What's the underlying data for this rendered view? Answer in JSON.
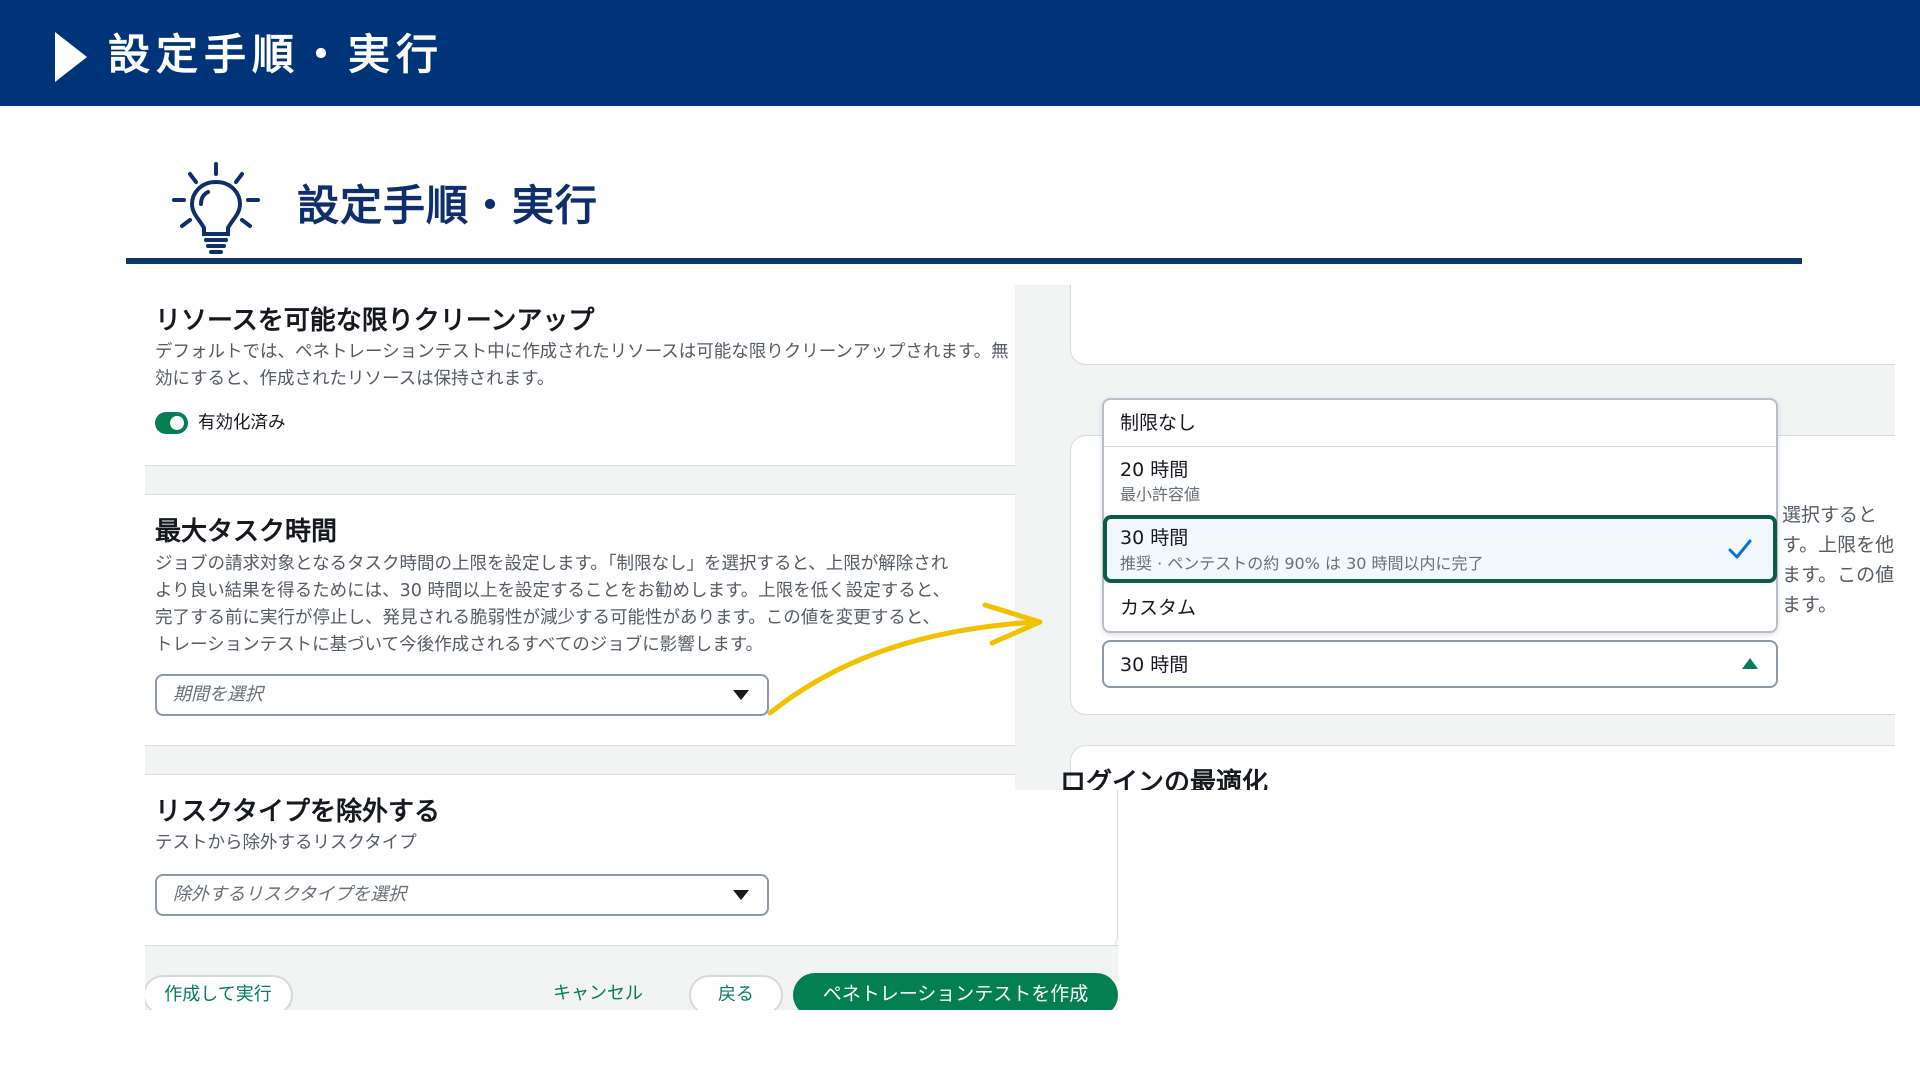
{
  "header": {
    "title": "設定手順・実行"
  },
  "section": {
    "title": "設定手順・実行"
  },
  "left": {
    "cleanup": {
      "title": "リソースを可能な限りクリーンアップ",
      "desc_line1": "デフォルトでは、ペネトレーションテスト中に作成されたリソースは可能な限りクリーンアップされます。無",
      "desc_line2": "効にすると、作成されたリソースは保持されます。",
      "toggle_label": "有効化済み",
      "toggle_state": "on"
    },
    "max_task": {
      "title": "最大タスク時間",
      "desc_line1": "ジョブの請求対象となるタスク時間の上限を設定します。「制限なし」を選択すると、上限が解除され",
      "desc_line2": "より良い結果を得るためには、30 時間以上を設定することをお勧めします。上限を低く設定すると、",
      "desc_line3": "完了する前に実行が停止し、発見される脆弱性が減少する可能性があります。この値を変更すると、",
      "desc_line4": "トレーションテストに基づいて今後作成されるすべてのジョブに影響します。",
      "placeholder": "期間を選択"
    },
    "exclude_risk": {
      "title": "リスクタイプを除外する",
      "desc": "テストから除外するリスクタイプ",
      "placeholder": "除外するリスクタイプを選択"
    },
    "buttons": {
      "create_and_run": "作成して実行",
      "cancel": "キャンセル",
      "back": "戻る",
      "create_pentest": "ペネトレーションテストを作成"
    }
  },
  "right": {
    "side_text": [
      "選択すると",
      "す。上限を他",
      "ます。この値",
      "ます。"
    ],
    "next_section_peek": "ログインの最適化",
    "dropdown": {
      "options": [
        {
          "label": "制限なし",
          "sub": ""
        },
        {
          "label": "20 時間",
          "sub": "最小許容値"
        },
        {
          "label": "30 時間",
          "sub": "推奨 · ペンテストの約 90% は 30 時間以内に完了",
          "selected": true
        },
        {
          "label": "カスタム",
          "sub": ""
        }
      ],
      "check_glyph": "✓"
    },
    "select_value": "30 時間"
  },
  "colors": {
    "header_bg": "#003478",
    "accent_green": "#037f51",
    "selected_border": "#0b5e45",
    "arrow_yellow": "#f2c200"
  }
}
